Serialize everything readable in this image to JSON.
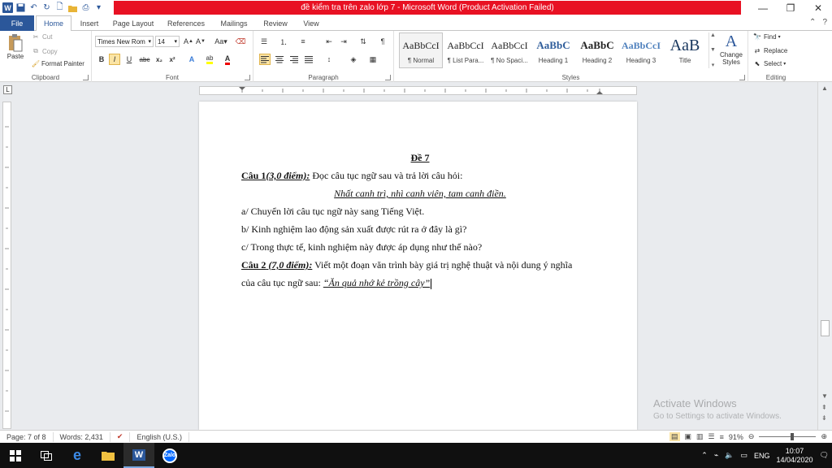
{
  "window": {
    "title": "đề kiểm tra trên zalo lớp 7 - Microsoft Word (Product Activation Failed)",
    "controls": [
      "—",
      "❐",
      "✕"
    ]
  },
  "tabs": [
    "File",
    "Home",
    "Insert",
    "Page Layout",
    "References",
    "Mailings",
    "Review",
    "View"
  ],
  "ribbon": {
    "clipboard": {
      "label": "Clipboard",
      "paste": "Paste",
      "cut": "Cut",
      "copy": "Copy",
      "format_painter": "Format Painter"
    },
    "font": {
      "label": "Font",
      "name": "Times New Rom",
      "size": "14"
    },
    "paragraph": {
      "label": "Paragraph"
    },
    "styles": {
      "label": "Styles",
      "items": [
        {
          "sample": "AaBbCcI",
          "name": "¶ Normal"
        },
        {
          "sample": "AaBbCcI",
          "name": "¶ List Para..."
        },
        {
          "sample": "AaBbCcI",
          "name": "¶ No Spaci..."
        },
        {
          "sample": "AaBbC",
          "name": "Heading 1"
        },
        {
          "sample": "AaBbC",
          "name": "Heading 2"
        },
        {
          "sample": "AaBbCcI",
          "name": "Heading 3"
        },
        {
          "sample": "AaB",
          "name": "Title"
        }
      ],
      "change_styles": "Change Styles"
    },
    "editing": {
      "label": "Editing",
      "find": "Find",
      "replace": "Replace",
      "select": "Select"
    }
  },
  "document": {
    "title": "Đề 7",
    "q1_label": "Câu 1",
    "q1_points": "(3,0 điểm):",
    "q1_text": " Đọc câu tục ngữ sau và trả lời câu hỏi:",
    "proverb": "Nhất canh trì, nhì canh viên, tam canh điền.",
    "a": "a/ Chuyển lời câu tục ngữ này sang Tiếng Việt.",
    "b": "b/ Kinh nghiệm lao động sản xuất được rút ra ở đây là gì?",
    "c": "c/ Trong thực tế, kinh nghiệm này được áp dụng như thế nào?",
    "q2_label": "Câu 2",
    "q2_points": " (7,0 điểm):",
    "q2_text": " Viết một đoạn văn trình bày giá trị nghệ thuật và nội dung ý nghĩa",
    "q2_cont": "của câu tục ngữ sau:  ",
    "q2_quote": "“Ăn quả nhớ kẻ trồng cây”"
  },
  "status": {
    "page": "Page: 7 of 8",
    "words": "Words: 2,431",
    "language": "English (U.S.)",
    "zoom": "91%",
    "zoom_level": 0.55
  },
  "watermark": {
    "line1": "Activate Windows",
    "line2": "Go to Settings to activate Windows."
  },
  "taskbar": {
    "lang": "ENG",
    "time": "10:07",
    "date": "14/04/2020"
  },
  "colors": {
    "word_blue": "#2b579a",
    "title_red": "#e81123",
    "taskbar": "#101010"
  }
}
